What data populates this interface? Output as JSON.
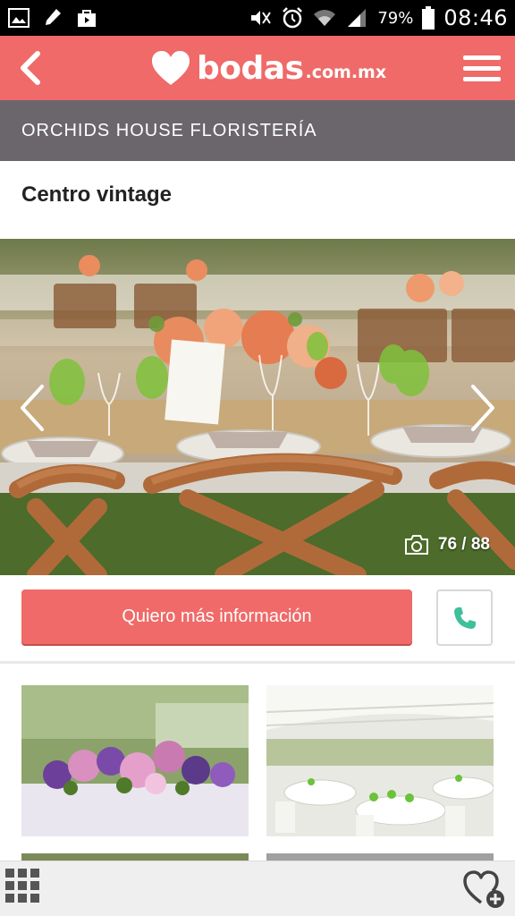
{
  "status_bar": {
    "battery": "79%",
    "time": "08:46",
    "left_icons": [
      "gallery-icon",
      "pencil-icon",
      "bag-icon"
    ],
    "right_icons": [
      "mute-icon",
      "alarm-icon",
      "wifi-icon",
      "signal-icon",
      "battery-icon"
    ]
  },
  "header": {
    "logo_word": "bodas",
    "logo_domain": ".com.mx",
    "back_icon": "chevron-left-icon",
    "menu_icon": "hamburger-icon"
  },
  "vendor": {
    "name": "ORCHIDS HOUSE FLORISTERÍA"
  },
  "page": {
    "title": "Centro vintage"
  },
  "photo": {
    "counter": "76 / 88",
    "current": 76,
    "total": 88
  },
  "actions": {
    "cta_label": "Quiero más información",
    "call_icon": "phone-icon"
  },
  "bottom_bar": {
    "grid_icon": "grid-icon",
    "favorite_icon": "heart-plus-icon"
  },
  "colors": {
    "brand": "#ef6a68",
    "vendor_bar": "#6a666c",
    "call_icon": "#3fbf9a"
  }
}
